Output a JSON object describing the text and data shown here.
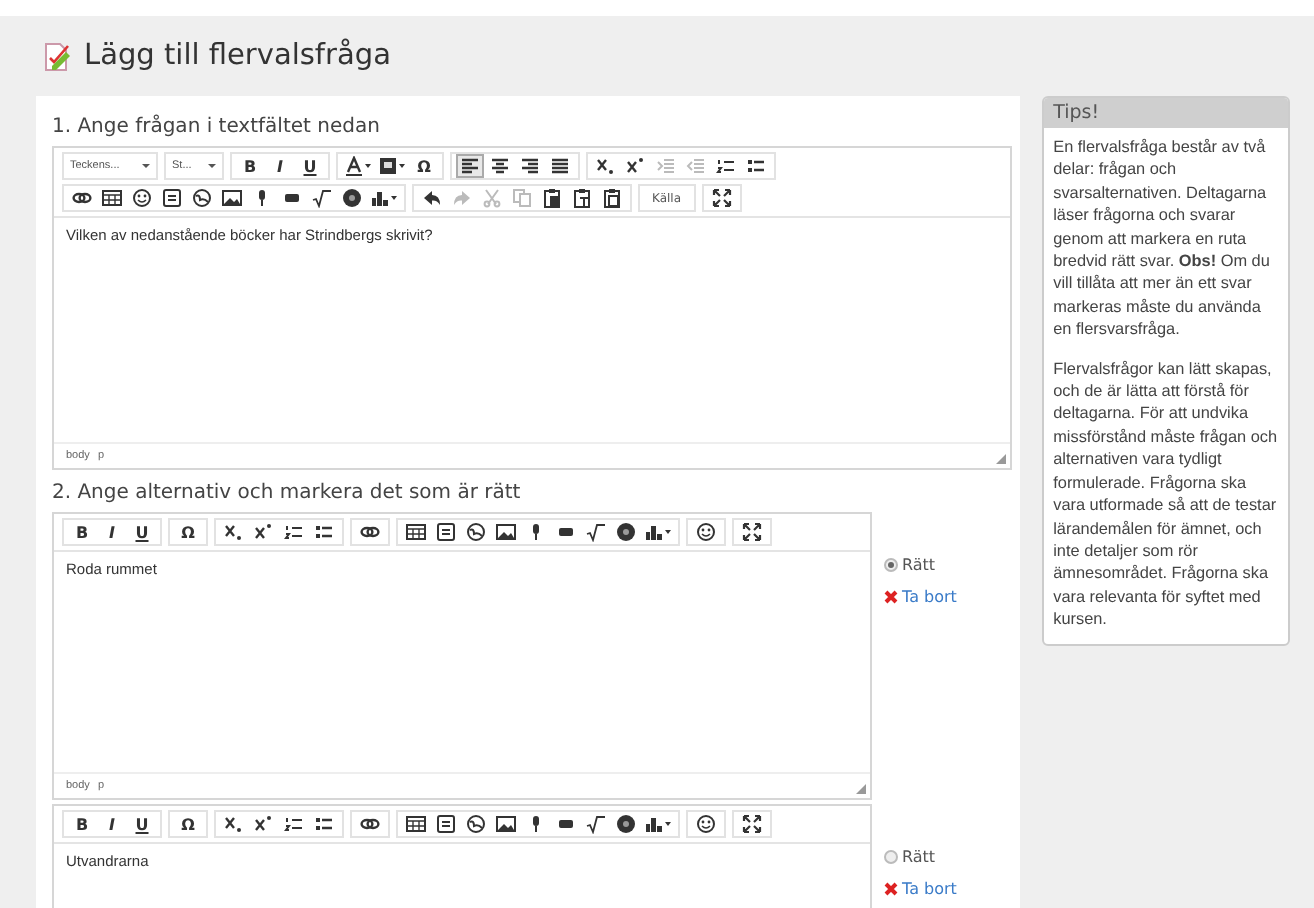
{
  "page_title": "Lägg till flervalsfråga",
  "question_section": {
    "heading": "1. Ange frågan i textfältet nedan",
    "editor": {
      "toolbar": {
        "font": "Teckens...",
        "size": "St...",
        "bold": "B",
        "italic": "I",
        "underline": "U",
        "special_char": "Ω",
        "alignment_buttons": [
          {
            "selected": true
          },
          {
            "selected": false
          },
          {
            "selected": false
          },
          {
            "selected": false
          }
        ],
        "source": "Källa"
      },
      "content": "Vilken av nedanstående böcker har Strindbergs skrivit?",
      "path": [
        "body",
        "p"
      ]
    }
  },
  "alternatives_section": {
    "heading": "2. Ange alternativ och markera det som är rätt",
    "alternatives": [
      {
        "editor": {
          "toolbar": {
            "bold": "B",
            "italic": "I",
            "underline": "U",
            "special_char": "Ω"
          },
          "content": "Roda rummet",
          "path": [
            "body",
            "p"
          ]
        },
        "correct_label": "Rätt",
        "selected": true,
        "remove_label": "Ta bort"
      },
      {
        "editor": {
          "toolbar": {
            "bold": "B",
            "italic": "I",
            "underline": "U",
            "special_char": "Ω"
          },
          "content": "Utvandrarna"
        },
        "correct_label": "Rätt",
        "selected": false,
        "remove_label": "Ta bort"
      }
    ]
  },
  "tips": {
    "title": "Tips!",
    "paragraphs": [
      "En flervalsfråga består av två delar: frågan och svarsalternativen. Deltagarna läser frågorna och svarar genom att markera en ruta bredvid rätt svar. **Obs!** Om du vill tillåta att mer än ett svar markeras måste du använda en flersvarsfråga.",
      "Flervalsfrågor kan lätt skapas, och de är lätta att förstå för deltagarna. För att undvika missförstånd måste frågan och alternativen vara tydligt formulerade. Frågorna ska vara utformade så att de testar lärandemålen för ämnet, och inte detaljer som rör ämnesområdet. Frågorna ska vara relevanta för syftet med kursen."
    ]
  }
}
